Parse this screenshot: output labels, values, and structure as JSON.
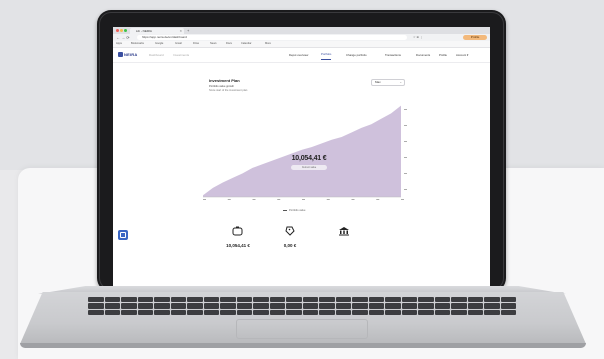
{
  "browser": {
    "tab_title": "Lib - NEIRA",
    "new_tab": "+",
    "nav": "←  →  ⟳",
    "url": "https://app.neira.de/en/dashboard",
    "toolbar_icons": "☆  ⊕  ⋮",
    "profile": "Profile",
    "bookmarks": [
      "Apps",
      "Bookmarks",
      "Google",
      "Gmail",
      "Drive",
      "News",
      "Docs",
      "Calendar",
      "More"
    ]
  },
  "site": {
    "logo": "NEIRA",
    "header_links": [
      "Dashboard",
      "Investments"
    ],
    "nav": [
      {
        "label": "Depot overview",
        "active": false
      },
      {
        "label": "Portfolio",
        "active": true
      },
      {
        "label": "Change portfolio",
        "active": false
      },
      {
        "label": "Transactions",
        "active": false
      },
      {
        "label": "Documents",
        "active": false
      },
      {
        "label": "Profile",
        "active": false
      },
      {
        "label": "Account ▾",
        "active": false
      }
    ]
  },
  "card": {
    "title": "Investment Plan",
    "subtitle": "Portfolio value growth",
    "note": "Since start of the investment plan",
    "period": "Max",
    "big_value": "10,054,41 €",
    "big_label": "Current value",
    "legend": "Portfolio value"
  },
  "chart_data": {
    "type": "area",
    "color": "#cfc1dc",
    "x": [
      0,
      1,
      2,
      3,
      4,
      5,
      6,
      7,
      8,
      9,
      10,
      11,
      12,
      13,
      14,
      15,
      16,
      17,
      18,
      19,
      20
    ],
    "y": [
      0.2,
      1.0,
      1.6,
      2.1,
      2.6,
      3.2,
      3.6,
      4.0,
      4.4,
      4.8,
      5.2,
      5.5,
      5.9,
      6.3,
      6.6,
      7.1,
      7.6,
      8.0,
      8.6,
      9.2,
      10.05
    ],
    "ylim": [
      0,
      11
    ]
  },
  "stats": [
    {
      "icon": "piggy-bank-icon",
      "value": "10,054,41 €"
    },
    {
      "icon": "tag-icon",
      "value": "0,00 €"
    },
    {
      "icon": "bank-icon",
      "value": ""
    }
  ]
}
